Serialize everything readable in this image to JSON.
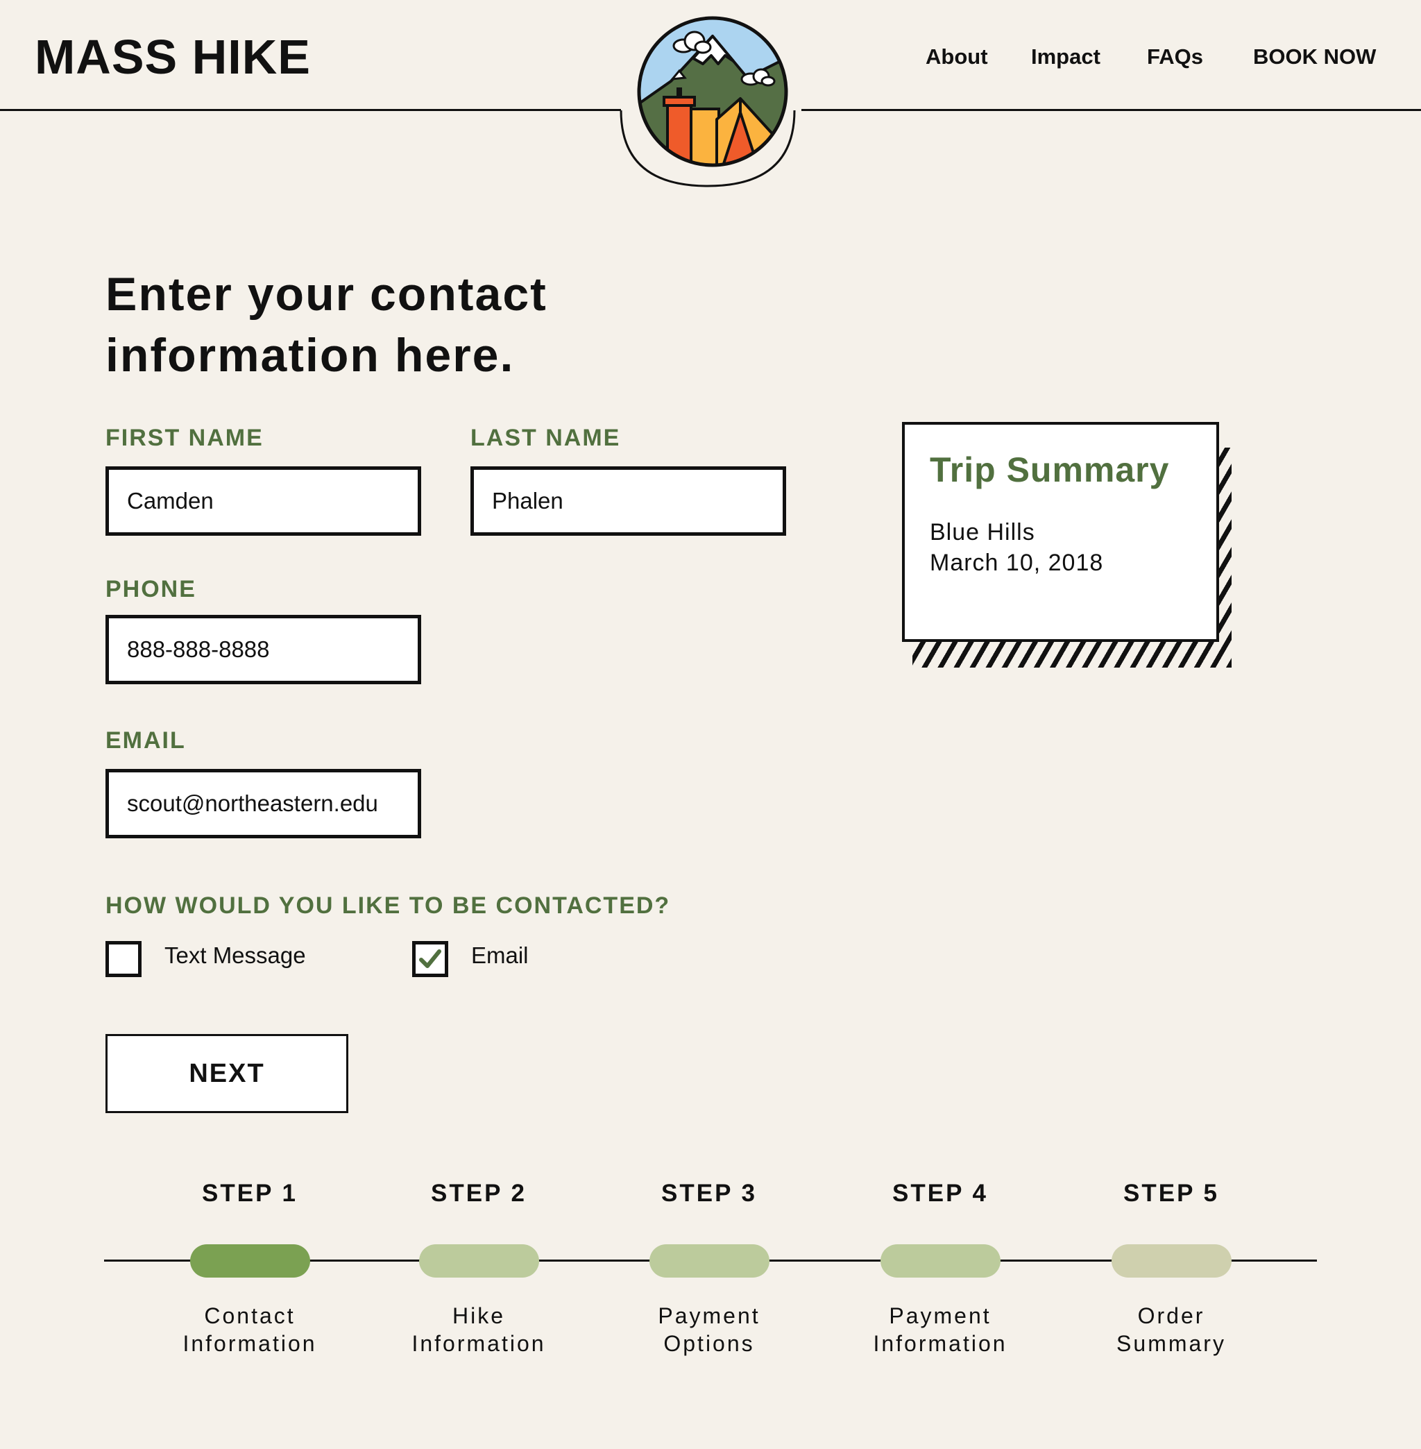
{
  "header": {
    "brand": "MASS HIKE",
    "nav": {
      "about": "About",
      "impact": "Impact",
      "faqs": "FAQs",
      "book_now": "BOOK NOW"
    }
  },
  "form": {
    "title_line1": "Enter your contact",
    "title_line2": "information here.",
    "first_name": {
      "label": "FIRST NAME",
      "value": "Camden"
    },
    "last_name": {
      "label": "LAST NAME",
      "value": "Phalen"
    },
    "phone": {
      "label": "PHONE",
      "value": "888-888-8888"
    },
    "email": {
      "label": "EMAIL",
      "value": "scout@northeastern.edu"
    },
    "contact_method": {
      "label": "HOW WOULD YOU LIKE TO BE CONTACTED?",
      "options": [
        {
          "label": "Text Message",
          "checked": false
        },
        {
          "label": "Email",
          "checked": true
        }
      ]
    },
    "next_label": "NEXT"
  },
  "trip_summary": {
    "title": "Trip Summary",
    "location": "Blue Hills",
    "date": "March 10, 2018"
  },
  "steps": [
    {
      "title": "STEP 1",
      "line1": "Contact",
      "line2": "Information",
      "active": true
    },
    {
      "title": "STEP 2",
      "line1": "Hike",
      "line2": "Information",
      "active": false
    },
    {
      "title": "STEP 3",
      "line1": "Payment",
      "line2": "Options",
      "active": false
    },
    {
      "title": "STEP 4",
      "line1": "Payment",
      "line2": "Information",
      "active": false
    },
    {
      "title": "STEP 5",
      "line1": "Order",
      "line2": "Summary",
      "active": false
    }
  ],
  "colors": {
    "background": "#f5f1ea",
    "accent_green": "#51703f",
    "active_step": "#7ba152",
    "inactive_step": "#bccb9c"
  }
}
